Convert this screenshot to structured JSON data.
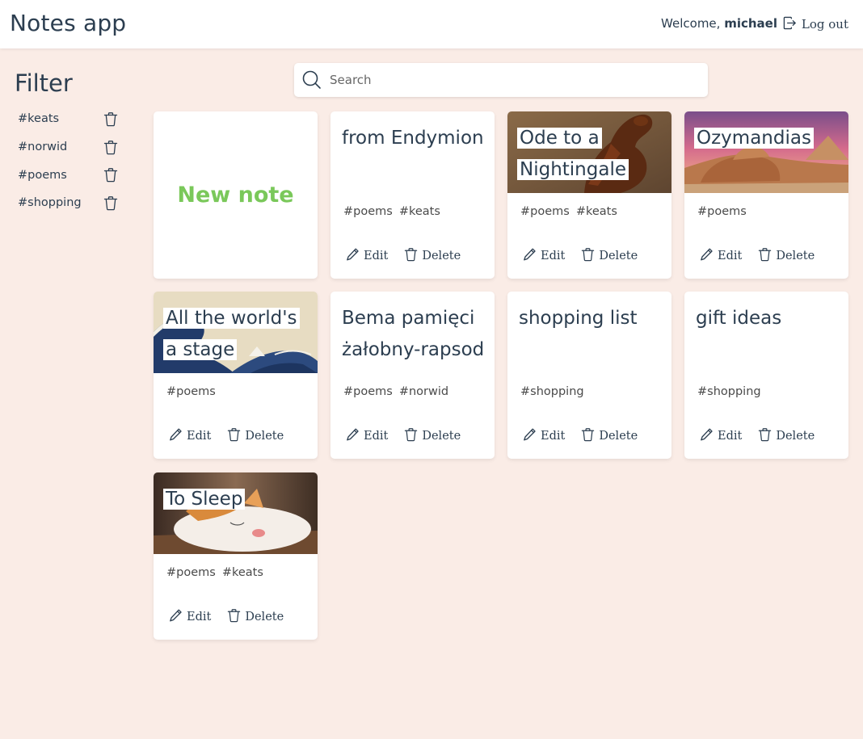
{
  "app": {
    "title": "Notes app"
  },
  "user": {
    "welcome_prefix": "Welcome,",
    "username": "michael",
    "logout_label": "Log out"
  },
  "filter": {
    "title": "Filter",
    "tags": [
      "#keats",
      "#norwid",
      "#poems",
      "#shopping"
    ]
  },
  "search": {
    "placeholder": "Search",
    "value": ""
  },
  "new_note_label": "New note",
  "action_labels": {
    "edit": "Edit",
    "delete": "Delete"
  },
  "notes": [
    {
      "title": "from Endymion",
      "tags": [
        "#poems",
        "#keats"
      ],
      "cover": ""
    },
    {
      "title": "Ode to a Nightingale",
      "tags": [
        "#poems",
        "#keats"
      ],
      "cover": "horse-painting"
    },
    {
      "title": "Ozymandias",
      "tags": [
        "#poems"
      ],
      "cover": "desert-sphinx"
    },
    {
      "title": "All the world's a stage",
      "tags": [
        "#poems"
      ],
      "cover": "great-wave"
    },
    {
      "title": "Bema pamięci żałobny-rapsod",
      "tags": [
        "#poems",
        "#norwid"
      ],
      "cover": ""
    },
    {
      "title": "shopping list",
      "tags": [
        "#shopping"
      ],
      "cover": ""
    },
    {
      "title": "gift ideas",
      "tags": [
        "#shopping"
      ],
      "cover": ""
    },
    {
      "title": "To Sleep",
      "tags": [
        "#poems",
        "#keats"
      ],
      "cover": "sleeping-cat"
    }
  ]
}
